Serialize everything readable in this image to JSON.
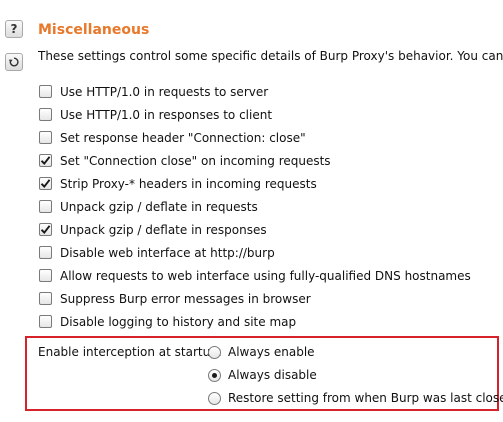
{
  "section": {
    "title": "Miscellaneous",
    "description": "These settings control some specific details of Burp Proxy's behavior. You can change"
  },
  "side_buttons": [
    {
      "icon": "help-icon",
      "glyph": "?"
    },
    {
      "icon": "restore-defaults-icon"
    }
  ],
  "options": [
    {
      "label": "Use HTTP/1.0 in requests to server",
      "checked": false
    },
    {
      "label": "Use HTTP/1.0 in responses to client",
      "checked": false
    },
    {
      "label": "Set response header \"Connection: close\"",
      "checked": false
    },
    {
      "label": "Set \"Connection close\" on incoming requests",
      "checked": true
    },
    {
      "label": "Strip Proxy-* headers in incoming requests",
      "checked": true
    },
    {
      "label": "Unpack gzip / deflate in requests",
      "checked": false
    },
    {
      "label": "Unpack gzip / deflate in responses",
      "checked": true
    },
    {
      "label": "Disable web interface at http://burp",
      "checked": false
    },
    {
      "label": "Allow requests to web interface using fully-qualified DNS hostnames",
      "checked": false
    },
    {
      "label": "Suppress Burp error messages in browser",
      "checked": false
    },
    {
      "label": "Disable logging to history and site map",
      "checked": false
    }
  ],
  "interception": {
    "label": "Enable interception at startup:",
    "choices": [
      {
        "label": "Always enable",
        "selected": false
      },
      {
        "label": "Always disable",
        "selected": true
      },
      {
        "label": "Restore setting from when Burp was last closed",
        "selected": false
      }
    ]
  },
  "colors": {
    "title": "#e8782a",
    "highlight_border": "#d6222a"
  }
}
